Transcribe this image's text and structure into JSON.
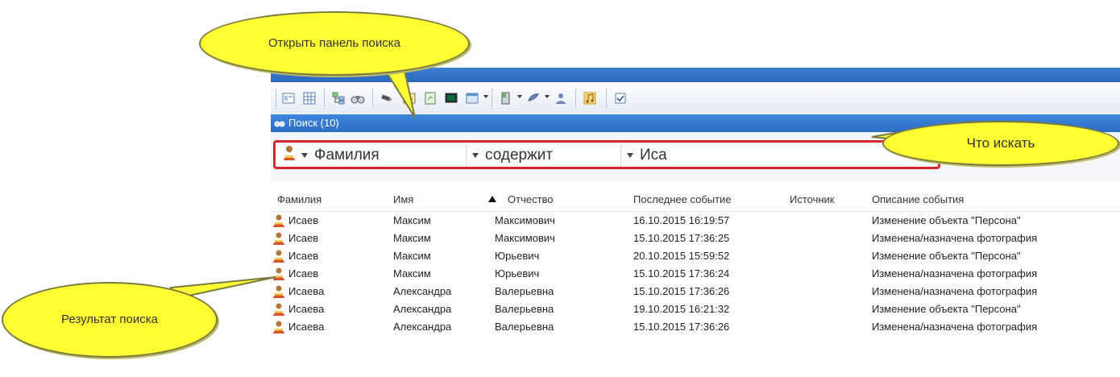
{
  "window": {
    "panel_title": "Поиск (10)"
  },
  "toolbar": {
    "icons": [
      "panel-icon",
      "grid-icon",
      "tree-icon",
      "binoculars-icon",
      "camera-icon",
      "map-icon",
      "report-icon",
      "monitor-icon",
      "window-icon",
      "door-icon",
      "wing-icon",
      "user-config-icon",
      "music-icon",
      "checkbox-icon"
    ]
  },
  "search": {
    "field": "Фамилия",
    "condition": "содержит",
    "value": "Иса"
  },
  "table": {
    "columns": [
      "Фамилия",
      "Имя",
      "Отчество",
      "Последнее событие",
      "Источник",
      "Описание события"
    ],
    "sorted_column": "Отчество",
    "rows": [
      {
        "last": "Исаев",
        "first": "Максим",
        "middle": "Максимович",
        "time": "16.10.2015 16:19:57",
        "source": "",
        "desc": "Изменение объекта \"Персона\""
      },
      {
        "last": "Исаев",
        "first": "Максим",
        "middle": "Максимович",
        "time": "15.10.2015 17:36:25",
        "source": "",
        "desc": "Изменена/назначена фотография"
      },
      {
        "last": "Исаев",
        "first": "Максим",
        "middle": "Юрьевич",
        "time": "20.10.2015 15:59:52",
        "source": "",
        "desc": "Изменение объекта \"Персона\""
      },
      {
        "last": "Исаев",
        "first": "Максим",
        "middle": "Юрьевич",
        "time": "15.10.2015 17:36:24",
        "source": "",
        "desc": "Изменена/назначена фотография"
      },
      {
        "last": "Исаева",
        "first": "Александра",
        "middle": "Валерьевна",
        "time": "15.10.2015 17:36:26",
        "source": "",
        "desc": "Изменена/назначена фотография"
      },
      {
        "last": "Исаева",
        "first": "Александра",
        "middle": "Валерьевна",
        "time": "19.10.2015 16:21:32",
        "source": "",
        "desc": "Изменение объекта \"Персона\""
      },
      {
        "last": "Исаева",
        "first": "Александра",
        "middle": "Валерьевна",
        "time": "15.10.2015 17:36:26",
        "source": "",
        "desc": "Изменена/назначена фотография"
      }
    ]
  },
  "callouts": {
    "open_panel": "Открыть панель поиска",
    "what_search": "Что искать",
    "result": "Результат поиска"
  },
  "colors": {
    "accent_blue": "#2d6cc4",
    "highlight_red": "#d8252c",
    "callout_yellow": "#ffff33"
  }
}
